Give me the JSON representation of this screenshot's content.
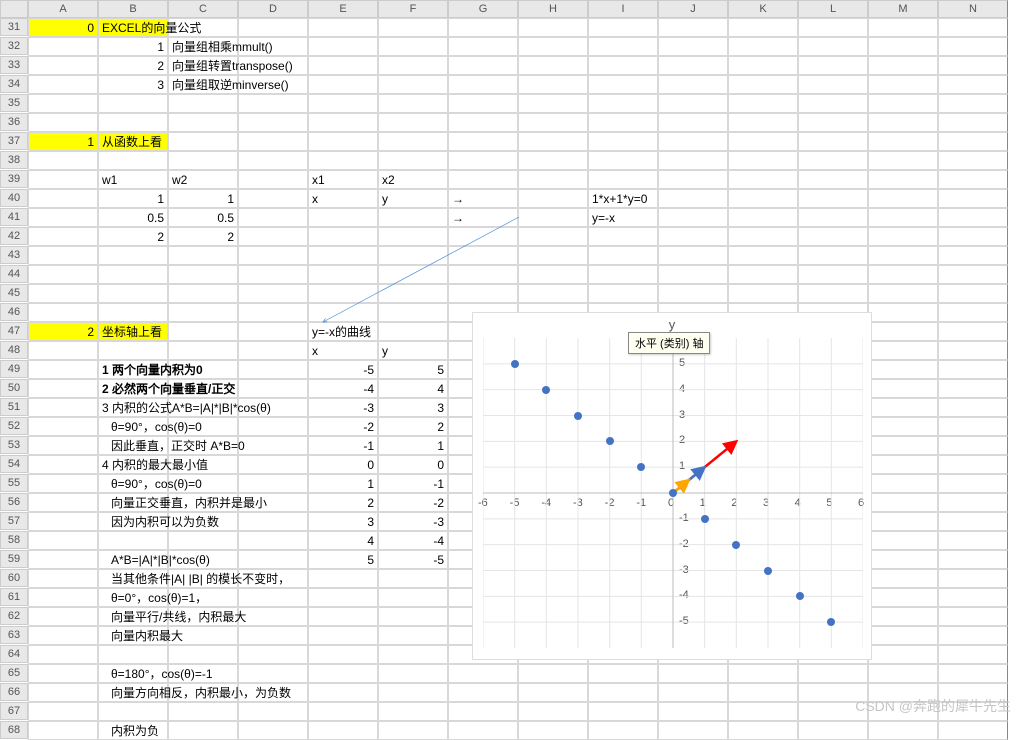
{
  "columns": [
    "A",
    "B",
    "C",
    "D",
    "E",
    "F",
    "G",
    "H",
    "I",
    "J",
    "K",
    "L",
    "M",
    "N"
  ],
  "rows": [
    "31",
    "32",
    "33",
    "34",
    "35",
    "36",
    "37",
    "38",
    "39",
    "40",
    "41",
    "42",
    "43",
    "44",
    "45",
    "46",
    "47",
    "48",
    "49",
    "50",
    "51",
    "52",
    "53",
    "54",
    "55",
    "56",
    "57",
    "58",
    "59",
    "60",
    "61",
    "62",
    "63",
    "64",
    "65",
    "66",
    "67",
    "68"
  ],
  "cells": {
    "r31": {
      "A_right": "0",
      "B": "EXCEL的向量公式"
    },
    "r32": {
      "B_right": "1",
      "C": "向量组相乘mmult()"
    },
    "r33": {
      "B_right": "2",
      "C": "向量组转置transpose()"
    },
    "r34": {
      "B_right": "3",
      "C": "向量组取逆minverse()"
    },
    "r37": {
      "A_right": "1",
      "B": "从函数上看"
    },
    "r39": {
      "B": "w1",
      "C": "w2",
      "E": "x1",
      "F": "x2"
    },
    "r40": {
      "B_right": "1",
      "C_right": "1",
      "E": "x",
      "F": "y",
      "G": "→",
      "I": "1*x+1*y=0"
    },
    "r41": {
      "B_right": "0.5",
      "C_right": "0.5",
      "G": "→",
      "I": "y=-x"
    },
    "r42": {
      "B_right": "2",
      "C_right": "2"
    },
    "r47": {
      "A_right": "2",
      "B": "坐标轴上看",
      "E": "y=-x的曲线"
    },
    "r48": {
      "E": "x",
      "F": "y"
    },
    "r49": {
      "B_bold": "1 两个向量内积为0",
      "E_right": "-5",
      "F_right": "5"
    },
    "r50": {
      "B_bold": "2 必然两个向量垂直/正交",
      "E_right": "-4",
      "F_right": "4"
    },
    "r51": {
      "B": "3 内积的公式A*B=|A|*|B|*cos(θ)",
      "E_right": "-3",
      "F_right": "3"
    },
    "r52": {
      "B_ind": "θ=90°，cos(θ)=0",
      "E_right": "-2",
      "F_right": "2"
    },
    "r53": {
      "B_ind": "因此垂直，正交时 A*B=0",
      "E_right": "-1",
      "F_right": "1"
    },
    "r54": {
      "B": "4 内积的最大最小值",
      "E_right": "0",
      "F_right": "0"
    },
    "r55": {
      "B_ind": "θ=90°，cos(θ)=0",
      "E_right": "1",
      "F_right": "-1"
    },
    "r56": {
      "B_ind": "向量正交垂直，内积并是最小",
      "E_right": "2",
      "F_right": "-2"
    },
    "r57": {
      "B_ind": "因为内积可以为负数",
      "E_right": "3",
      "F_right": "-3"
    },
    "r58": {
      "E_right": "4",
      "F_right": "-4"
    },
    "r59": {
      "B_ind": "A*B=|A|*|B|*cos(θ)",
      "E_right": "5",
      "F_right": "-5"
    },
    "r60": {
      "B_ind": "当其他条件|A| |B| 的模长不变时，"
    },
    "r61": {
      "B_ind": "θ=0°，cos(θ)=1，"
    },
    "r62": {
      "B_ind": "向量平行/共线，内积最大"
    },
    "r63": {
      "B_ind": "向量内积最大"
    },
    "r65": {
      "B_ind": "θ=180°，cos(θ)=-1"
    },
    "r66": {
      "B_ind": "向量方向相反，内积最小，为负数"
    },
    "r68": {
      "B_ind": "内积为负"
    }
  },
  "chart_data": {
    "type": "scatter",
    "title": "y",
    "tooltip": "水平 (类别) 轴",
    "xlim": [
      -6,
      6
    ],
    "ylim": [
      -6,
      6
    ],
    "xticks": [
      -6,
      -5,
      -4,
      -3,
      -2,
      -1,
      0,
      1,
      2,
      3,
      4,
      5,
      6
    ],
    "yticks": [
      -5,
      -4,
      -3,
      -2,
      -1,
      1,
      2,
      3,
      4,
      5
    ],
    "series": [
      {
        "name": "y=-x",
        "points": [
          [
            -5,
            5
          ],
          [
            -4,
            4
          ],
          [
            -3,
            3
          ],
          [
            -2,
            2
          ],
          [
            -1,
            1
          ],
          [
            0,
            0
          ],
          [
            1,
            -1
          ],
          [
            2,
            -2
          ],
          [
            3,
            -3
          ],
          [
            4,
            -4
          ],
          [
            5,
            -5
          ]
        ]
      }
    ],
    "arrows": [
      {
        "name": "red",
        "from": [
          0,
          0
        ],
        "to": [
          2,
          2
        ],
        "color": "#ff0000"
      },
      {
        "name": "blue",
        "from": [
          0,
          0
        ],
        "to": [
          1,
          1
        ],
        "color": "#4472c4"
      },
      {
        "name": "orange",
        "from": [
          0,
          0
        ],
        "to": [
          0.5,
          0.5
        ],
        "color": "#ffa500"
      }
    ]
  },
  "watermark": "CSDN @奔跑的犀牛先生"
}
